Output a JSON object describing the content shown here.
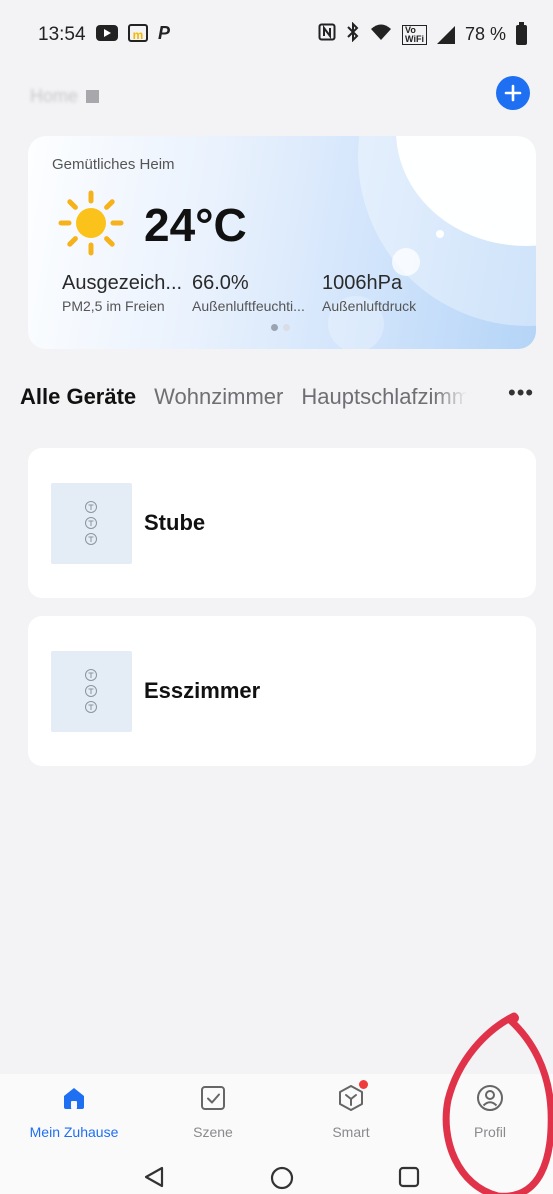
{
  "status_bar": {
    "time": "13:54",
    "battery": "78 %",
    "icons": [
      "youtube-icon",
      "mcdonalds-icon",
      "paypal-icon",
      "nfc-icon",
      "bluetooth-icon",
      "wifi-icon",
      "volte-wifi-icon",
      "signal-icon",
      "battery-icon"
    ]
  },
  "header": {
    "home_name": "Home",
    "add_icon": "plus-icon",
    "accent": "#1f6ff2"
  },
  "weather": {
    "location": "Gemütliches Heim",
    "temperature": "24°C",
    "icon": "sun-icon",
    "stats": [
      {
        "value": "Ausgezeich...",
        "label": "PM2,5 im Freien"
      },
      {
        "value": "66.0%",
        "label": "Außenluftfeuchti..."
      },
      {
        "value": "1006hPa",
        "label": "Außenluftdruck"
      }
    ],
    "pages": 2,
    "active_page": 1
  },
  "tabs": {
    "items": [
      "Alle Geräte",
      "Wohnzimmer",
      "Hauptschlafzimmer"
    ],
    "active_index": 0,
    "more_icon": "more-horizontal-icon"
  },
  "devices": [
    {
      "name": "Stube",
      "icon": "light-switch-icon"
    },
    {
      "name": "Esszimmer",
      "icon": "light-switch-icon"
    }
  ],
  "bottom_nav": {
    "items": [
      {
        "label": "Mein Zuhause",
        "icon": "home-icon",
        "active": true
      },
      {
        "label": "Szene",
        "icon": "scene-checkbox-icon",
        "active": false
      },
      {
        "label": "Smart",
        "icon": "smart-cube-icon",
        "active": false,
        "badge": true
      },
      {
        "label": "Profil",
        "icon": "profile-icon",
        "active": false
      }
    ]
  },
  "system_nav": {
    "icons": [
      "back-icon",
      "home-circle-icon",
      "recents-icon"
    ]
  },
  "annotation": {
    "color": "#e0334a",
    "shape": "hand-drawn-circle"
  }
}
